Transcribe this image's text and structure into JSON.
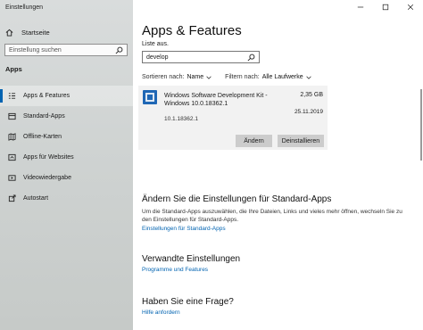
{
  "window": {
    "title": "Einstellungen"
  },
  "sidebar": {
    "home_label": "Startseite",
    "search_placeholder": "Einstellung suchen",
    "section_title": "Apps",
    "items": [
      {
        "label": "Apps & Features",
        "icon": "apps-list-icon",
        "active": true
      },
      {
        "label": "Standard-Apps",
        "icon": "default-apps-icon"
      },
      {
        "label": "Offline-Karten",
        "icon": "map-icon"
      },
      {
        "label": "Apps für Websites",
        "icon": "website-apps-icon"
      },
      {
        "label": "Videowiedergabe",
        "icon": "video-icon"
      },
      {
        "label": "Autostart",
        "icon": "startup-icon"
      }
    ]
  },
  "main": {
    "title": "Apps & Features",
    "list_label": "Liste aus.",
    "search_value": "develop",
    "sort_label": "Sortieren nach:",
    "sort_value": "Name",
    "filter_label": "Filtern nach:",
    "filter_value": "Alle Laufwerke",
    "app": {
      "name": "Windows Software Development Kit - Windows 10.0.18362.1",
      "size": "2,35 GB",
      "date": "25.11.2019",
      "version": "10.1.18362.1",
      "modify_label": "Ändern",
      "uninstall_label": "Deinstallieren"
    },
    "default_apps": {
      "title": "Ändern Sie die Einstellungen für Standard-Apps",
      "text": "Um die Standard-Apps auszuwählen, die Ihre Dateien, Links und vieles mehr öffnen, wechseln Sie zu den Einstellungen für Standard-Apps.",
      "link": "Einstellungen für Standard-Apps"
    },
    "related": {
      "title": "Verwandte Einstellungen",
      "link": "Programme und Features"
    },
    "question": {
      "title": "Haben Sie eine Frage?",
      "link": "Hilfe anfordern"
    }
  },
  "colors": {
    "accent": "#0063b1",
    "sidebar_bg": "#cfd3d2",
    "card_bg": "#f2f2f2",
    "button_bg": "#cccccc"
  }
}
